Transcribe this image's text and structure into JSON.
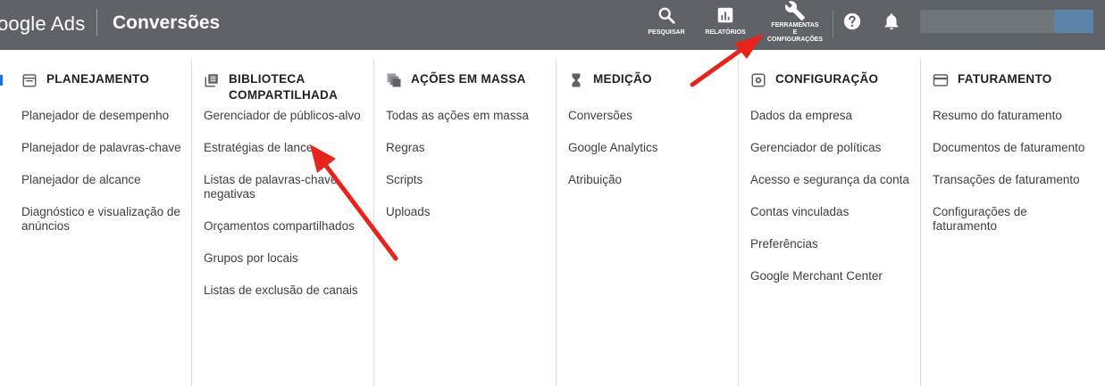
{
  "header": {
    "brand": "oogle Ads",
    "page_title": "Conversões",
    "actions": [
      {
        "id": "search",
        "label": "PESQUISAR",
        "icon": "search-icon"
      },
      {
        "id": "reports",
        "label": "RELATÓRIOS",
        "icon": "bar-chart-icon"
      },
      {
        "id": "tools",
        "label_lines": [
          "FERRAMENTAS",
          "E",
          "CONFIGURAÇÕES"
        ],
        "icon": "wrench-icon"
      },
      {
        "id": "help",
        "icon": "help-icon"
      },
      {
        "id": "notifications",
        "icon": "bell-icon"
      }
    ]
  },
  "menu": {
    "columns": [
      {
        "title": "PLANEJAMENTO",
        "icon": "calendar-icon",
        "items": [
          "Planejador de desempenho",
          "Planejador de palavras-chave",
          "Planejador de alcance",
          "Diagnóstico e visualização de anúncios"
        ]
      },
      {
        "title": "BIBLIOTECA COMPARTILHADA",
        "icon": "library-icon",
        "items": [
          "Gerenciador de públicos-alvo",
          "Estratégias de lance",
          "Listas de palavras-chave negativas",
          "Orçamentos compartilhados",
          "Grupos por locais",
          "Listas de exclusão de canais"
        ]
      },
      {
        "title": "AÇÕES EM MASSA",
        "icon": "copy-stack-icon",
        "items": [
          "Todas as ações em massa",
          "Regras",
          "Scripts",
          "Uploads"
        ]
      },
      {
        "title": "MEDIÇÃO",
        "icon": "hourglass-icon",
        "items": [
          "Conversões",
          "Google Analytics",
          "Atribuição"
        ]
      },
      {
        "title": "CONFIGURAÇÃO",
        "icon": "settings-icon",
        "items": [
          "Dados da empresa",
          "Gerenciador de políticas",
          "Acesso e segurança da conta",
          "Contas vinculadas",
          "Preferências",
          "Google Merchant Center"
        ]
      },
      {
        "title": "FATURAMENTO",
        "icon": "credit-card-icon",
        "items": [
          "Resumo do faturamento",
          "Documentos de faturamento",
          "Transações de faturamento",
          "Configurações de faturamento"
        ]
      }
    ]
  },
  "colors": {
    "topbar": "#5f6368",
    "annotation_arrow": "#e8231c",
    "menu_text": "#3c4043"
  }
}
